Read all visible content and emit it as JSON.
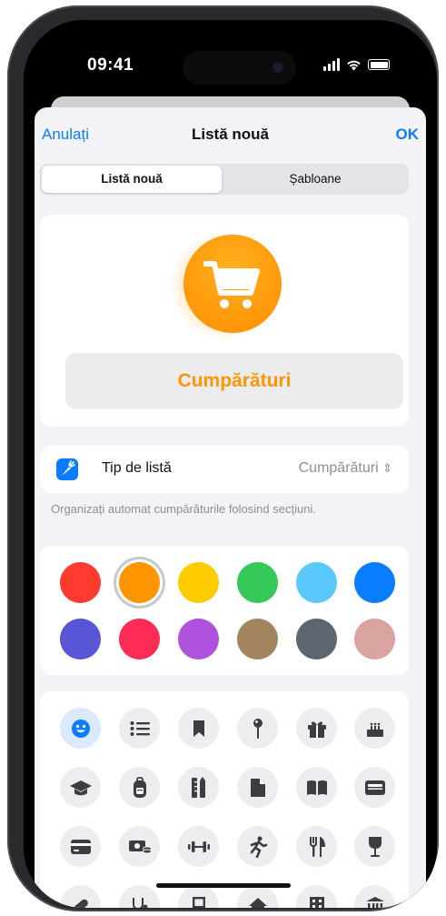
{
  "status_bar": {
    "time": "09:41"
  },
  "nav": {
    "cancel": "Anulați",
    "title": "Listă nouă",
    "done": "OK"
  },
  "segmented": {
    "options": [
      "Listă nouă",
      "Șabloane"
    ],
    "selected": "Listă nouă"
  },
  "list_name": {
    "value": "Cumpărături",
    "icon": "cart-icon"
  },
  "list_type": {
    "label": "Tip de listă",
    "value": "Cumpărături",
    "footer": "Organizați automat cumpărăturile folosind secțiuni."
  },
  "colors": {
    "selected_index": 1,
    "swatches": [
      "#ff3b30",
      "#ff9500",
      "#ffcc00",
      "#34c759",
      "#5ac8fa",
      "#0a7cff",
      "#5856d6",
      "#ff2d55",
      "#af52de",
      "#a2845e",
      "#5d6670",
      "#d9a3a0"
    ]
  },
  "icons": {
    "selected": "smiley-icon",
    "items": [
      "smiley-icon",
      "list-icon",
      "bookmark-icon",
      "pin-icon",
      "gift-icon",
      "cake-icon",
      "graduation-cap-icon",
      "backpack-icon",
      "ruler-pencil-icon",
      "document-icon",
      "book-icon",
      "wallet-icon",
      "credit-card-icon",
      "money-icon",
      "dumbbell-icon",
      "running-icon",
      "fork-knife-icon",
      "wineglass-icon",
      "pill-icon",
      "stethoscope-icon",
      "chair-icon",
      "house-icon",
      "building-icon",
      "bank-icon"
    ]
  }
}
